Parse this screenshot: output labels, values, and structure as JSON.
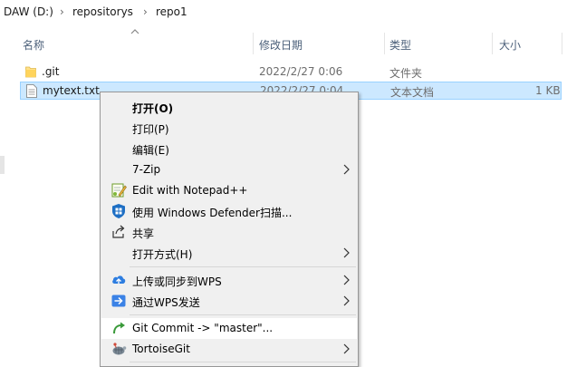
{
  "breadcrumb": {
    "drive": "DAW (D:)",
    "folder1": "repositorys",
    "folder2": "repo1",
    "separator": "›"
  },
  "columns": {
    "name": "名称",
    "date": "修改日期",
    "type": "类型",
    "size": "大小"
  },
  "files": [
    {
      "name": ".git",
      "date": "2022/2/27 0:06",
      "type": "文件夹",
      "size": "",
      "icon": "folder-icon"
    },
    {
      "name": "mytext.txt",
      "date": "2022/2/27 0:04",
      "type": "文本文档",
      "size": "1 KB",
      "icon": "text-file-icon",
      "selected": true
    }
  ],
  "context_menu": {
    "items": [
      {
        "label": "打开(O)",
        "bold": true
      },
      {
        "label": "打印(P)"
      },
      {
        "label": "编辑(E)"
      },
      {
        "label": "7-Zip",
        "submenu": true
      },
      {
        "label": "Edit with Notepad++",
        "icon": "notepad-plus-plus-icon"
      },
      {
        "label": "使用 Windows Defender扫描...",
        "icon": "windows-defender-icon"
      },
      {
        "label": "共享",
        "icon": "share-icon"
      },
      {
        "label": "打开方式(H)",
        "submenu": true
      },
      {
        "label": "上传或同步到WPS",
        "icon": "cloud-upload-icon",
        "submenu": true
      },
      {
        "label": "通过WPS发送",
        "icon": "wps-send-icon",
        "submenu": true
      },
      {
        "label": "Git Commit -> \"master\"...",
        "icon": "git-commit-icon",
        "hovered": true
      },
      {
        "label": "TortoiseGit",
        "icon": "tortoisegit-icon",
        "submenu": true
      }
    ]
  }
}
